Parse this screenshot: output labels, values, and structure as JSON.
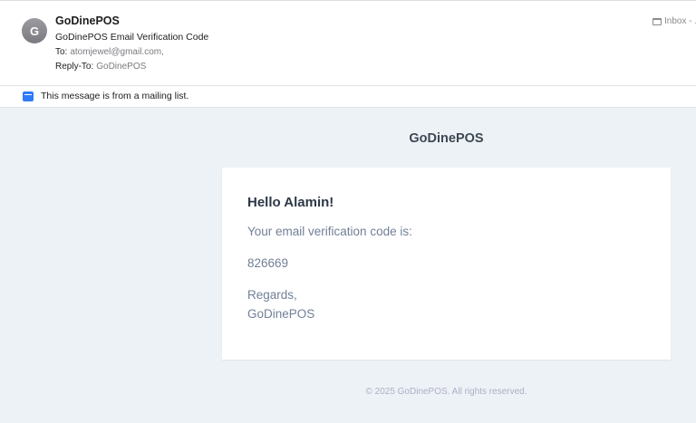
{
  "header": {
    "avatar_letter": "G",
    "sender_name": "GoDinePOS",
    "subject": "GoDinePOS Email Verification Code",
    "to_label": "To:",
    "to_value": "atomjewel@gmail.com,",
    "reply_to_label": "Reply-To:",
    "reply_to_value": "GoDinePOS",
    "mailbox_label": "Inbox - ."
  },
  "notice": {
    "text": "This message is from a mailing list."
  },
  "email": {
    "brand": "GoDinePOS",
    "greeting": "Hello Alamin!",
    "intro": "Your email verification code is:",
    "code": "826669",
    "regards": "Regards,",
    "signature": "GoDinePOS",
    "footer": "© 2025 GoDinePOS. All rights reserved."
  },
  "colors": {
    "accent_blue": "#2f7cf6",
    "body_background": "#edf2f7",
    "card_background": "#ffffff",
    "heading_text": "#2d3748",
    "body_text": "#718096"
  },
  "icons": {
    "avatar": "avatar-circle",
    "mailbox": "inbox-tray-icon",
    "mailing_list": "mailing-list-icon"
  }
}
